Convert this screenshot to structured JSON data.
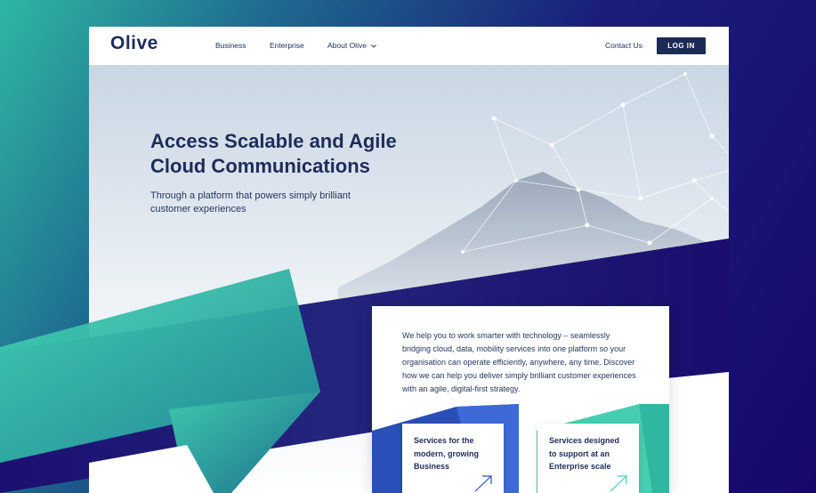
{
  "brand": {
    "logo_text": "Olive"
  },
  "nav": {
    "items": [
      {
        "label": "Business"
      },
      {
        "label": "Enterprise"
      },
      {
        "label": "About Olive"
      }
    ],
    "contact_label": "Contact Us",
    "login_label": "LOG IN"
  },
  "hero": {
    "title_line1": "Access Scalable and Agile",
    "title_line2": "Cloud Communications",
    "subtitle": "Through a platform that powers simply brilliant customer experiences"
  },
  "intro_card": {
    "text": "We help you to work smarter with technology – seamlessly bridging cloud, data, mobility services into one platform so your organisation can operate efficiently, anywhere, any time. Discover how we can help you deliver simply brilliant customer experiences with an agile, digital-first strategy.",
    "services": [
      {
        "label": "Services for the modern, growing Business"
      },
      {
        "label": "Services designed to support at an Enterprise scale"
      }
    ]
  },
  "colors": {
    "navy": "#1d2c5a",
    "teal": "#3fd0b0",
    "deep_blue": "#1a0f73"
  }
}
